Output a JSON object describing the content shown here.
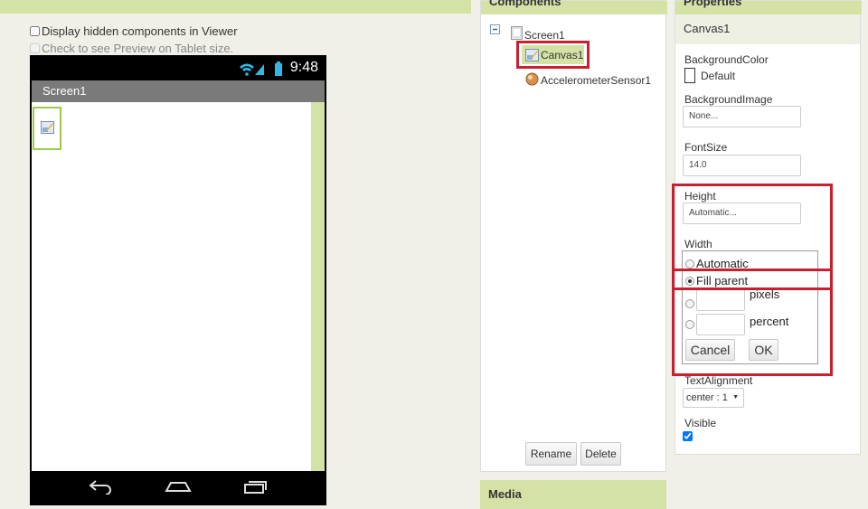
{
  "viewer": {
    "options": {
      "display_hidden": "Display hidden components in Viewer",
      "tablet_preview": "Check to see Preview on Tablet size."
    },
    "phone": {
      "time": "9:48",
      "screen_title": "Screen1"
    }
  },
  "components": {
    "title": "Components",
    "tree": {
      "root": "Screen1",
      "children": [
        "Canvas1",
        "AccelerometerSensor1"
      ]
    },
    "buttons": {
      "rename": "Rename",
      "delete": "Delete"
    }
  },
  "media": {
    "title": "Media"
  },
  "properties": {
    "title": "Properties",
    "component": "Canvas1",
    "background_color": {
      "label": "BackgroundColor",
      "value": "Default"
    },
    "background_image": {
      "label": "BackgroundImage",
      "value": "None..."
    },
    "font_size": {
      "label": "FontSize",
      "value": "14.0"
    },
    "height": {
      "label": "Height",
      "value": "Automatic..."
    },
    "width": {
      "label": "Width",
      "options": {
        "automatic": "Automatic",
        "fill_parent": "Fill parent",
        "pixels": "pixels",
        "percent": "percent"
      },
      "selected": "Fill parent",
      "buttons": {
        "cancel": "Cancel",
        "ok": "OK"
      }
    },
    "text_alignment": {
      "label": "TextAlignment",
      "value": "center : 1"
    },
    "visible": {
      "label": "Visible",
      "checked": true
    }
  },
  "colors": {
    "accent_green": "#d4e3a5",
    "highlight_red": "#c8202f"
  }
}
